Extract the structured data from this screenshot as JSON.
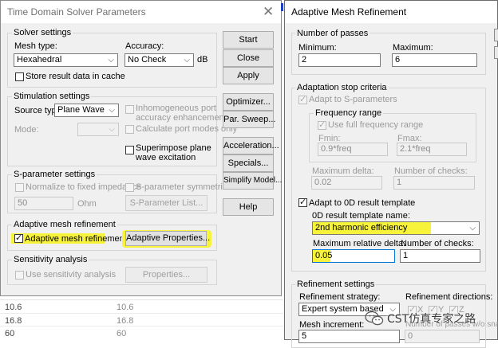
{
  "background_table": {
    "rows": [
      {
        "a": "10.6",
        "b": "10.6"
      },
      {
        "a": "16.8",
        "b": "16.8"
      },
      {
        "a": "60",
        "b": "60"
      }
    ]
  },
  "tds": {
    "title": "Time Domain Solver Parameters",
    "close_glyph": "✕",
    "solver": {
      "legend": "Solver settings",
      "mesh_type_label": "Mesh type:",
      "mesh_type_value": "Hexahedral",
      "accuracy_label": "Accuracy:",
      "accuracy_value": "No Check",
      "db_label": "dB",
      "store_result_label": "Store result data in cache"
    },
    "stimulation": {
      "legend": "Stimulation settings",
      "source_type_label": "Source type:",
      "source_type_value": "Plane Wave",
      "mode_label": "Mode:",
      "inhomogeneous_label_1": "Inhomogeneous port",
      "inhomogeneous_label_2": "accuracy enhancement",
      "calc_port_modes_label": "Calculate port modes only",
      "superimpose_label_1": "Superimpose plane",
      "superimpose_label_2": "wave excitation"
    },
    "sparam": {
      "legend": "S-parameter settings",
      "normalize_label": "Normalize to fixed impedance",
      "impedance_value": "50",
      "ohm_label": "Ohm",
      "symmetries_label": "S-parameter symmetries",
      "list_button": "S-Parameter List..."
    },
    "amr": {
      "legend": "Adaptive mesh refinement",
      "checkbox_label": "Adaptive mesh refinement",
      "properties_button": "Adaptive Properties..."
    },
    "sensitivity": {
      "legend": "Sensitivity analysis",
      "checkbox_label": "Use sensitivity analysis",
      "properties_button": "Properties..."
    },
    "buttons": {
      "start": "Start",
      "close": "Close",
      "apply": "Apply",
      "optimizer": "Optimizer...",
      "par_sweep": "Par. Sweep...",
      "acceleration": "Acceleration...",
      "specials": "Specials...",
      "simplify": "Simplify Model...",
      "help": "Help"
    }
  },
  "amr_dialog": {
    "title": "Adaptive Mesh Refinement",
    "passes": {
      "legend": "Number of passes",
      "min_label": "Minimum:",
      "min_value": "2",
      "max_label": "Maximum:",
      "max_value": "6"
    },
    "stop_criteria": {
      "legend": "Adaptation stop criteria",
      "adapt_sparams_label": "Adapt to S-parameters",
      "freq_range_legend": "Frequency range",
      "full_range_label": "Use full frequency range",
      "fmin_label": "Fmin:",
      "fmin_value": "0.9*freq",
      "fmax_label": "Fmax:",
      "fmax_value": "2.1*freq",
      "max_delta_label": "Maximum delta:",
      "max_delta_value": "0.02",
      "num_checks_label": "Number of checks:",
      "num_checks_value": "1",
      "adapt_0d_label": "Adapt to 0D result template",
      "template_name_label": "0D result template name:",
      "template_name_value": "2nd harmonic efficiency",
      "max_rel_delta_label": "Maximum relative delta:",
      "max_rel_delta_value": "0.05",
      "checks_label": "Number of checks:",
      "checks_value": "1"
    },
    "refinement": {
      "legend": "Refinement settings",
      "strategy_label": "Refinement strategy:",
      "strategy_value": "Expert system based",
      "directions_label": "Refinement directions:",
      "dir_x": "X",
      "dir_y": "Y",
      "dir_z": "Z",
      "increment_label": "Mesh increment:",
      "increment_value": "5",
      "snap_label": "Number of passes w/o snap:",
      "snap_value": "0"
    }
  },
  "watermark": {
    "text": "CST仿真专家之路"
  },
  "colors": {
    "highlight": "#f7f33a",
    "dialog_bg": "#f0f0f0",
    "focus_border": "#0078d7"
  }
}
